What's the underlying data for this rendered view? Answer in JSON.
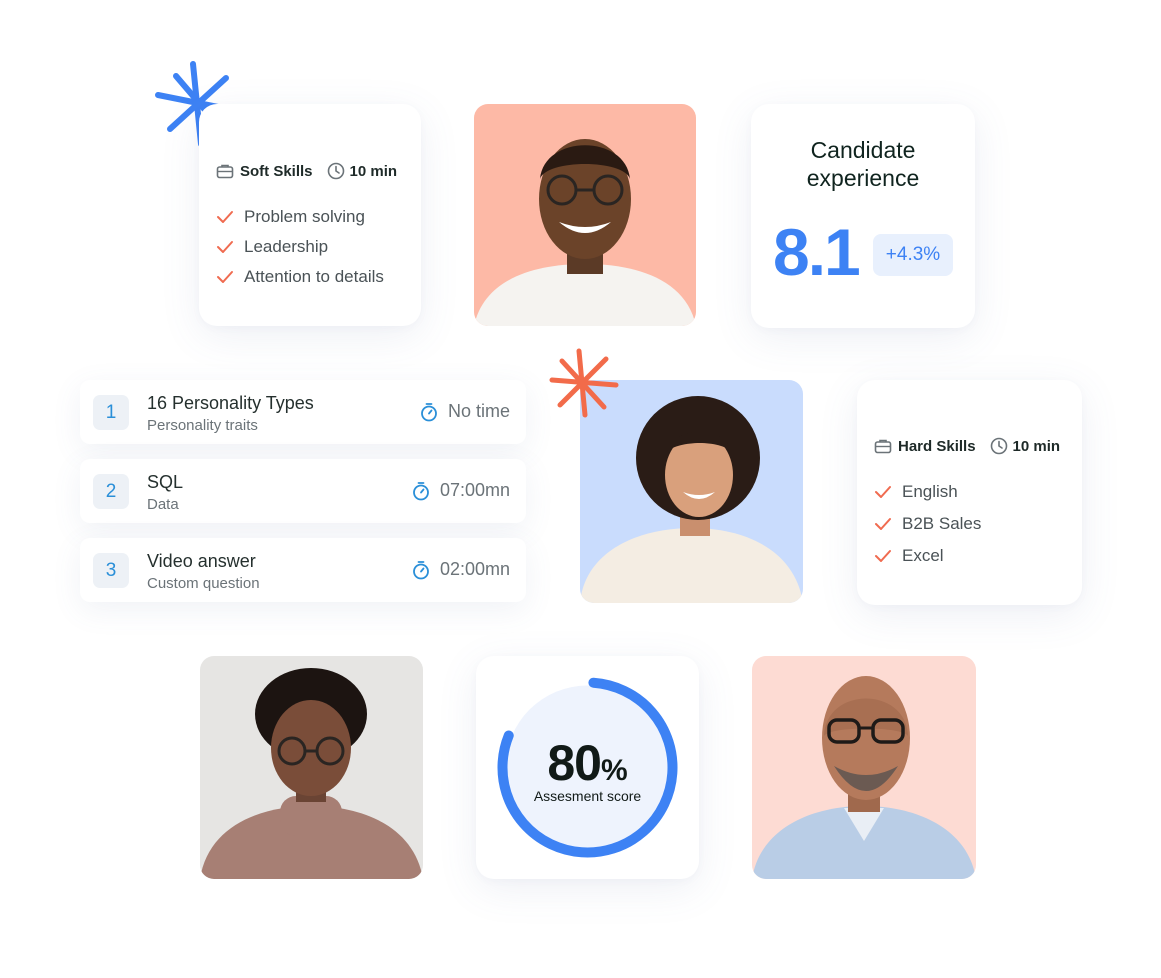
{
  "soft_skills": {
    "title": "Soft Skills",
    "duration": "10 min",
    "items": [
      "Problem solving",
      "Leadership",
      "Attention to details"
    ]
  },
  "candidate_experience": {
    "title_line1": "Candidate",
    "title_line2": "experience",
    "score": "8.1",
    "change": "+4.3%"
  },
  "tests": [
    {
      "number": "1",
      "title": "16 Personality Types",
      "subtitle": "Personality traits",
      "time": "No time"
    },
    {
      "number": "2",
      "title": "SQL",
      "subtitle": "Data",
      "time": "07:00mn"
    },
    {
      "number": "3",
      "title": "Video answer",
      "subtitle": "Custom question",
      "time": "02:00mn"
    }
  ],
  "hard_skills": {
    "title": "Hard Skills",
    "duration": "10 min",
    "items": [
      "English",
      "B2B Sales",
      "Excel"
    ]
  },
  "assessment": {
    "value": "80",
    "unit": "%",
    "label": "Assesment score",
    "progress_fraction": 0.8
  },
  "colors": {
    "accent_blue": "#3d82f4",
    "accent_orange": "#f26b4a",
    "check": "#f06b50",
    "photo_bg_salmon": "#fdb9a6",
    "photo_bg_blue": "#c9dcfd",
    "photo_bg_grey": "#e6e5e3",
    "photo_bg_pink": "#fddbd3"
  },
  "icons": {
    "skills": "briefcase-icon",
    "duration": "clock-icon",
    "list_check": "checkmark-icon",
    "test_time": "stopwatch-icon",
    "decoration": "asterisk-sparkle-icon"
  }
}
